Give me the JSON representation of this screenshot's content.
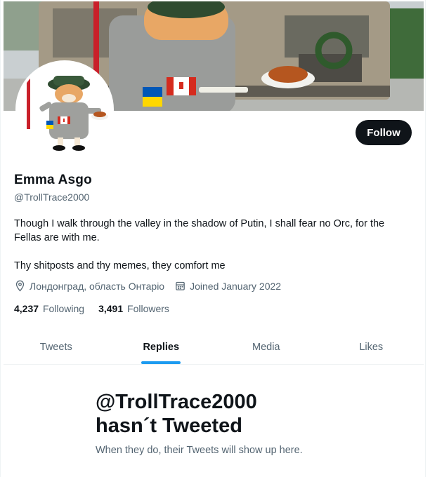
{
  "profile": {
    "name": "Emma Asgo",
    "handle": "@TrollTrace2000",
    "bio_line1": "Though I walk through the valley in the shadow of Putin, I shall fear no Orc, for the Fellas are with me.",
    "bio_line2": "Thy shitposts and thy memes, they comfort me",
    "location": "Лондонград, область Онтаріо",
    "joined": "Joined January 2022"
  },
  "actions": {
    "follow_label": "Follow"
  },
  "stats": {
    "following_count": "4,237",
    "following_label": "Following",
    "followers_count": "3,491",
    "followers_label": "Followers"
  },
  "tabs": [
    {
      "label": "Tweets",
      "active": false
    },
    {
      "label": "Replies",
      "active": true
    },
    {
      "label": "Media",
      "active": false
    },
    {
      "label": "Likes",
      "active": false
    }
  ],
  "empty_state": {
    "title_line1": "@TrollTrace2000",
    "title_line2": "hasn´t Tweeted",
    "subtitle": "When they do, their Tweets will show up here."
  },
  "icons": {
    "location": "location-pin-icon",
    "joined": "calendar-icon"
  },
  "colors": {
    "accent": "#1d9bf0",
    "text_primary": "#0f1419",
    "text_secondary": "#536471",
    "follow_bg": "#0f1419"
  }
}
